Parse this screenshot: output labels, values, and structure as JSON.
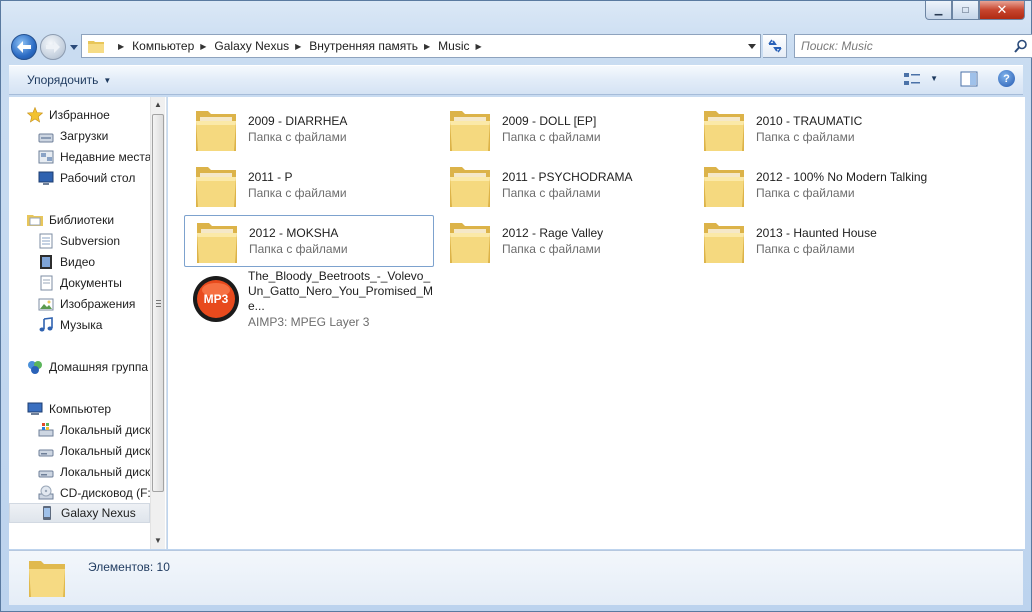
{
  "window": {
    "caption_buttons": {
      "minimize": "▁",
      "maximize": "□",
      "close": "✕"
    }
  },
  "nav": {
    "back_icon": "arrow-left-icon",
    "forward_icon": "arrow-right-icon"
  },
  "address": {
    "crumbs": [
      "Компьютер",
      "Galaxy Nexus",
      "Внутренняя память",
      "Music"
    ]
  },
  "search": {
    "placeholder": "Поиск: Music"
  },
  "commandbar": {
    "organize_label": "Упорядочить"
  },
  "sidebar": {
    "items": [
      {
        "label": "Избранное",
        "icon": "star-icon",
        "kind": "group"
      },
      {
        "label": "Загрузки",
        "icon": "downloads-icon",
        "kind": "child"
      },
      {
        "label": "Недавние места",
        "icon": "recent-places-icon",
        "kind": "child"
      },
      {
        "label": "Рабочий стол",
        "icon": "desktop-icon",
        "kind": "child"
      },
      {
        "label": "Библиотеки",
        "icon": "libraries-icon",
        "kind": "group"
      },
      {
        "label": "Subversion",
        "icon": "document-library-icon",
        "kind": "child"
      },
      {
        "label": "Видео",
        "icon": "video-icon",
        "kind": "child"
      },
      {
        "label": "Документы",
        "icon": "documents-icon",
        "kind": "child"
      },
      {
        "label": "Изображения",
        "icon": "pictures-icon",
        "kind": "child"
      },
      {
        "label": "Музыка",
        "icon": "music-icon",
        "kind": "child"
      },
      {
        "label": "Домашняя группа",
        "icon": "homegroup-icon",
        "kind": "group"
      },
      {
        "label": "Компьютер",
        "icon": "computer-icon",
        "kind": "group"
      },
      {
        "label": "Локальный диск",
        "icon": "system-drive-icon",
        "kind": "child"
      },
      {
        "label": "Локальный диск",
        "icon": "drive-icon",
        "kind": "child"
      },
      {
        "label": "Локальный диск",
        "icon": "drive-icon",
        "kind": "child"
      },
      {
        "label": "CD-дисковод (F:",
        "icon": "cd-drive-icon",
        "kind": "child"
      },
      {
        "label": "Galaxy Nexus",
        "icon": "phone-icon",
        "kind": "child",
        "selected": true
      }
    ]
  },
  "files": [
    {
      "name": "2009 - DIARRHEA",
      "type": "Папка с файлами",
      "icon": "folder-icon"
    },
    {
      "name": "2009 - DOLL [EP]",
      "type": "Папка с файлами",
      "icon": "folder-icon"
    },
    {
      "name": "2010 - TRAUMATIC",
      "type": "Папка с файлами",
      "icon": "folder-icon"
    },
    {
      "name": "2011 - P",
      "type": "Папка с файлами",
      "icon": "folder-icon"
    },
    {
      "name": "2011 - PSYCHODRAMA",
      "type": "Папка с файлами",
      "icon": "folder-icon"
    },
    {
      "name": "2012 - 100% No Modern Talking",
      "type": "Папка с файлами",
      "icon": "folder-icon"
    },
    {
      "name": "2012 - MOKSHA",
      "type": "Папка с файлами",
      "icon": "folder-icon",
      "selected": true
    },
    {
      "name": "2012 - Rage Valley",
      "type": "Папка с файлами",
      "icon": "folder-icon"
    },
    {
      "name": "2013 - Haunted House",
      "type": "Папка с файлами",
      "icon": "folder-icon"
    },
    {
      "name": "The_Bloody_Beetroots_-_Volevo_Un_Gatto_Nero_You_Promised_Me...",
      "type": "AIMP3: MPEG Layer 3",
      "icon": "mp3-icon",
      "badge": "MP3"
    }
  ],
  "details": {
    "count_label": "Элементов: 10"
  },
  "colors": {
    "accent": "#2c6cc4",
    "selection_border": "#7da2ce",
    "folder": "#f1d479"
  }
}
